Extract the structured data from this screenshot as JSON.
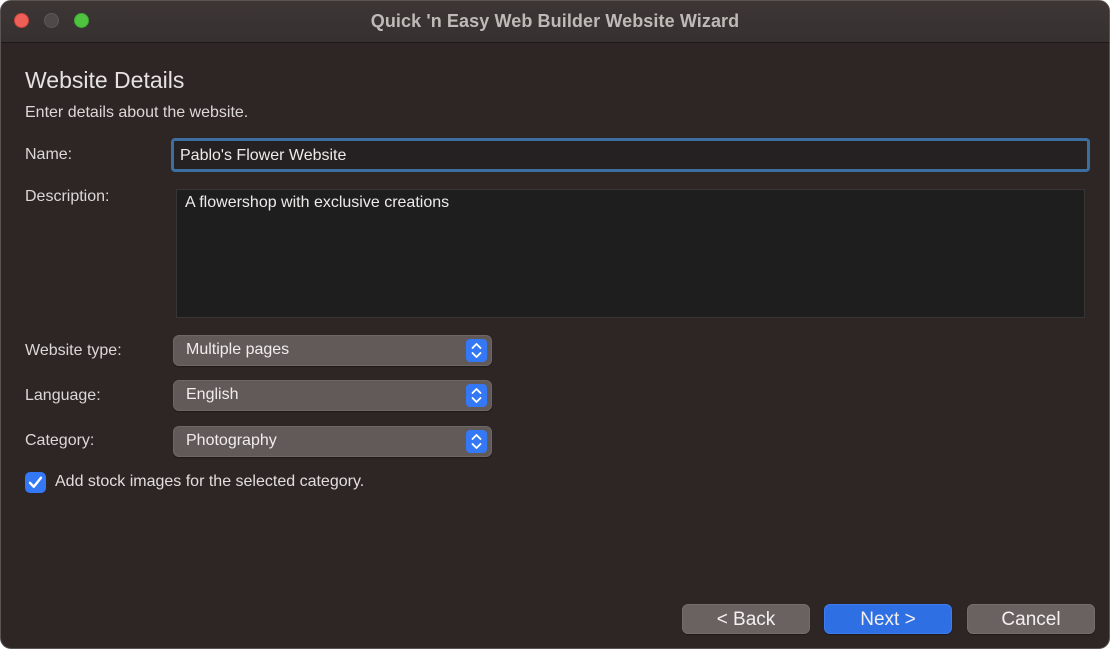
{
  "window": {
    "title": "Quick 'n Easy Web Builder Website Wizard"
  },
  "page": {
    "heading": "Website Details",
    "subheading": "Enter details about the website."
  },
  "form": {
    "name_label": "Name:",
    "name_value": "Pablo's Flower Website",
    "description_label": "Description:",
    "description_value": "A flowershop with exclusive creations",
    "website_type_label": "Website type:",
    "website_type_value": "Multiple pages",
    "language_label": "Language:",
    "language_value": "English",
    "category_label": "Category:",
    "category_value": "Photography",
    "stock_images_label": "Add stock images for the selected category.",
    "stock_images_checked": true
  },
  "buttons": {
    "back": "< Back",
    "next": "Next >",
    "cancel": "Cancel"
  },
  "colors": {
    "accent": "#3478f6",
    "window_bg": "#2d2625",
    "close": "#ee5f58",
    "zoom": "#4fc33f"
  },
  "icons": {
    "select_arrow": "chevron-up-down-icon",
    "checkbox": "checkmark-icon"
  }
}
